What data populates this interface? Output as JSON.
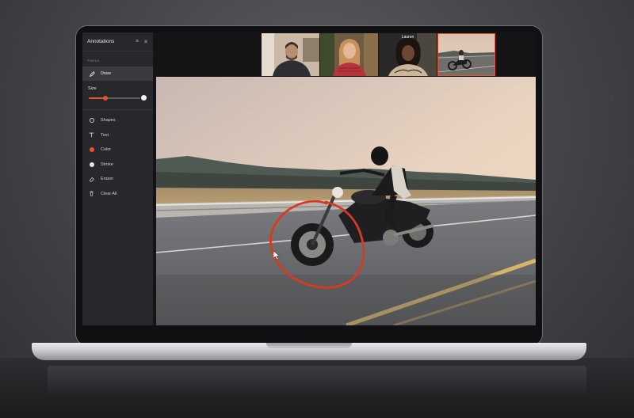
{
  "sidebar": {
    "title": "Annotations",
    "header_icons": [
      "menu-icon",
      "close-icon"
    ],
    "section_label": "TOOLS",
    "active_tool": {
      "label": "Draw",
      "icon": "pencil-icon"
    },
    "size": {
      "label": "Size",
      "value": 0.33
    },
    "tools": [
      {
        "label": "Shapes",
        "icon": "circle-outline-icon"
      },
      {
        "label": "Text",
        "icon": "text-t-icon"
      },
      {
        "label": "Color",
        "icon": "color-dot-icon",
        "color": "#e9502c"
      },
      {
        "label": "Stroke",
        "icon": "stroke-dot-icon",
        "color": "#e6e6e6"
      },
      {
        "label": "Eraser",
        "icon": "eraser-icon"
      },
      {
        "label": "Clear All",
        "icon": "trash-icon"
      }
    ]
  },
  "participants": [
    {
      "name": "",
      "icon": "participant-man-video"
    },
    {
      "name": "",
      "icon": "participant-woman-video"
    },
    {
      "name": "Lauren",
      "icon": "participant-lauren-video"
    },
    {
      "name": "",
      "icon": "shared-screen-thumbnail"
    }
  ],
  "colors": {
    "accent": "#e9502c",
    "annotation_stroke": "#d9391f",
    "sidebar_bg": "#27282b",
    "active_tile_border": "#e2562f"
  }
}
